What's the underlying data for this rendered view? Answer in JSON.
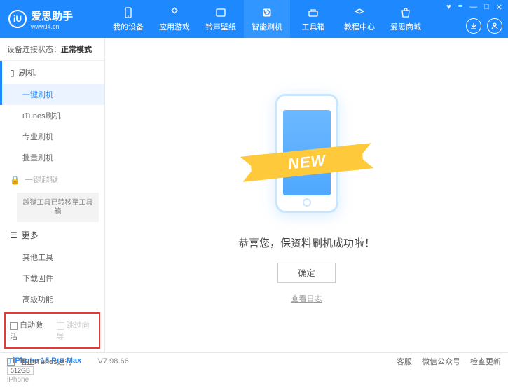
{
  "app": {
    "name": "爱思助手",
    "url": "www.i4.cn"
  },
  "nav": {
    "items": [
      {
        "label": "我的设备"
      },
      {
        "label": "应用游戏"
      },
      {
        "label": "铃声壁纸"
      },
      {
        "label": "智能刷机"
      },
      {
        "label": "工具箱"
      },
      {
        "label": "教程中心"
      },
      {
        "label": "爱思商城"
      }
    ],
    "activeIndex": 3
  },
  "sidebar": {
    "connLabel": "设备连接状态：",
    "connStatus": "正常模式",
    "groups": {
      "flash": "刷机",
      "jailbreak": "一键越狱",
      "more": "更多"
    },
    "items": {
      "onekey": "一键刷机",
      "itunes": "iTunes刷机",
      "pro": "专业刷机",
      "batch": "批量刷机",
      "jbTool": "越狱工具已转移至工具箱",
      "other": "其他工具",
      "download": "下载固件",
      "advanced": "高级功能"
    },
    "checkboxes": {
      "autoActivate": "自动激活",
      "skipGuide": "跳过向导"
    },
    "device": {
      "name": "iPhone 15 Pro Max",
      "storage": "512GB",
      "type": "iPhone"
    }
  },
  "main": {
    "newLabel": "NEW",
    "successText": "恭喜您，保资料刷机成功啦！",
    "okButton": "确定",
    "logLink": "查看日志"
  },
  "footer": {
    "blockItunes": "阻止iTunes运行",
    "version": "V7.98.66",
    "right": {
      "support": "客服",
      "wechat": "微信公众号",
      "update": "检查更新"
    }
  }
}
